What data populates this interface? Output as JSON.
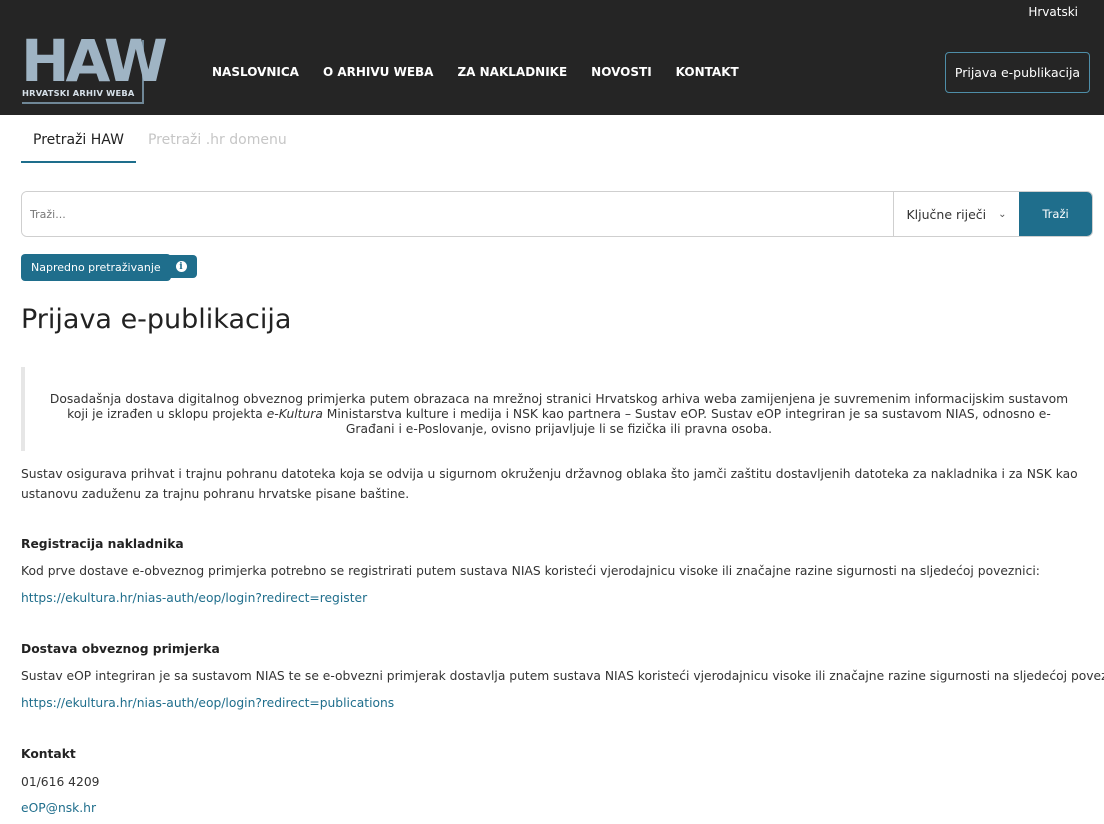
{
  "header": {
    "language": "Hrvatski",
    "logo_text": "HAW",
    "logo_subtitle": "HRVATSKI ARHIV WEBA",
    "nav": [
      "NASLOVNICA",
      "O ARHIVU WEBA",
      "ZA NAKLADNIKE",
      "NOVOSTI",
      "KONTAKT"
    ],
    "login_button": "Prijava e-publikacija"
  },
  "tabs": [
    "Pretraži HAW",
    "Pretraži .hr domenu"
  ],
  "search": {
    "placeholder": "Traži...",
    "select_value": "Ključne riječi",
    "button": "Traži"
  },
  "advanced_search": "Napredno pretraživanje",
  "info_icon": "info-icon",
  "page_title": "Prijava e-publikacija",
  "quote": {
    "part1": "Dosadašnja dostava digitalnog obveznog primjerka putem obrazaca na mrežnoj stranici Hrvatskog arhiva weba zamijenjena je suvremenim informacijskim sustavom koji je izrađen u sklopu projekta ",
    "emphasis": "e-Kultura",
    "part2": " Ministarstva kulture i medija i NSK kao partnera – Sustav eOP. Sustav eOP integriran je sa sustavom NIAS, odnosno e-Građani i e-Poslovanje, ovisno prijavljuje li se fizička ili pravna osoba."
  },
  "intro": "Sustav osigurava prihvat i trajnu pohranu datoteka koja se odvija u sigurnom okruženju državnog oblaka što jamči zaštitu dostavljenih datoteka za nakladnika i za NSK kao ustanovu zaduženu za trajnu pohranu hrvatske pisane baštine.",
  "registration": {
    "heading": "Registracija nakladnika",
    "text": "Kod prve dostave e-obveznog primjerka potrebno se registrirati putem sustava NIAS koristeći vjerodajnicu visoke ili značajne razine sigurnosti na sljedećoj poveznici:",
    "link": "https://ekultura.hr/nias-auth/eop/login?redirect=register"
  },
  "delivery": {
    "heading": "Dostava obveznog primjerka",
    "text": "Sustav eOP integriran je sa sustavom NIAS te se e-obvezni primjerak dostavlja putem sustava NIAS koristeći vjerodajnicu visoke ili značajne razine sigurnosti na sljedećoj poveznici:",
    "link": "https://ekultura.hr/nias-auth/eop/login?redirect=publications"
  },
  "contact": {
    "heading": "Kontakt",
    "phone": "01/616 4209",
    "email": "eOP@nsk.hr"
  }
}
